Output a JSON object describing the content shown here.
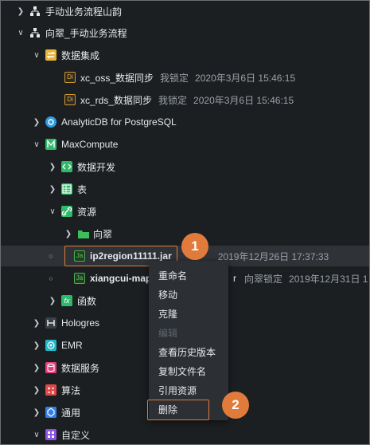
{
  "tree": {
    "n1": {
      "label": "手动业务流程山韵"
    },
    "n2": {
      "label": "向翠_手动业务流程"
    },
    "n3": {
      "label": "数据集成"
    },
    "n4": {
      "label": "xc_oss_数据同步",
      "locked_by": "我锁定",
      "time": "2020年3月6日 15:46:15",
      "icon": "Di"
    },
    "n5": {
      "label": "xc_rds_数据同步",
      "locked_by": "我锁定",
      "time": "2020年3月6日 15:46:15",
      "icon": "Di"
    },
    "n6": {
      "label": "AnalyticDB for PostgreSQL"
    },
    "n7": {
      "label": "MaxCompute"
    },
    "n8": {
      "label": "数据开发"
    },
    "n9": {
      "label": "表"
    },
    "n10": {
      "label": "资源"
    },
    "n11": {
      "label": "向翠"
    },
    "n12": {
      "label": "ip2region11111.jar",
      "time": "2019年12月26日 17:37:33",
      "icon": "Ja"
    },
    "n13": {
      "label": "xiangcui-mapr",
      "suffix": "r",
      "locked_by": "向翠锁定",
      "time": "2019年12月31日 1",
      "icon": "Ja"
    },
    "n14": {
      "label": "函数",
      "icon": "fx"
    },
    "n15": {
      "label": "Hologres"
    },
    "n16": {
      "label": "EMR"
    },
    "n17": {
      "label": "数据服务"
    },
    "n18": {
      "label": "算法"
    },
    "n19": {
      "label": "通用"
    },
    "n20": {
      "label": "自定义"
    }
  },
  "context_menu": {
    "rename": "重命名",
    "move": "移动",
    "clone": "克隆",
    "disabled_item": "编辑",
    "history": "查看历史版本",
    "copy_name": "复制文件名",
    "reference": "引用资源",
    "delete": "删除"
  },
  "callouts": {
    "one": "1",
    "two": "2"
  },
  "colors": {
    "accent": "#e07b3c",
    "background": "#1c1f22",
    "menu": "#2c3034"
  }
}
